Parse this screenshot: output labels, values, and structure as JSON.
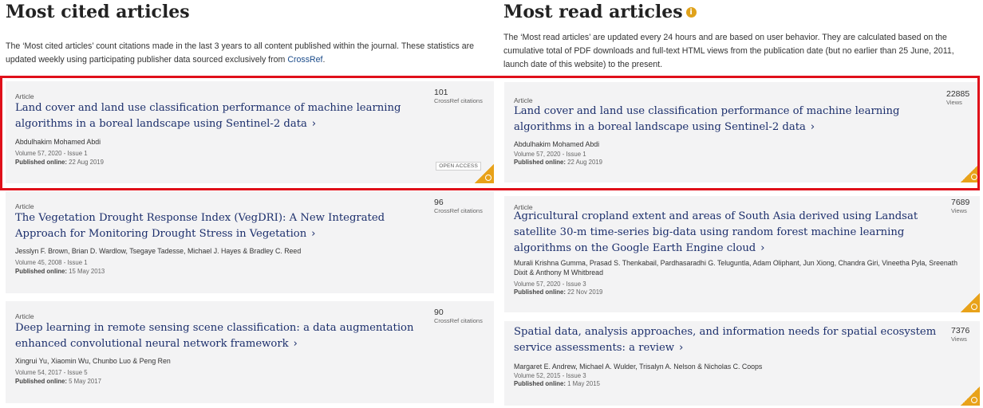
{
  "most_cited": {
    "title": "Most cited articles",
    "desc_pre": "The ‘Most cited articles’ count citations made in the last 3 years to all content published within the journal. These statistics are updated weekly using participating publisher data sourced exclusively from ",
    "desc_link": "CrossRef",
    "desc_post": ".",
    "articles": [
      {
        "type": "Article",
        "title": "Land cover and land use classification performance of machine learning algorithms in a boreal landscape using Sentinel-2 data",
        "authors": "Abdulhakim Mohamed Abdi",
        "volume": "Volume 57, 2020 - Issue 1",
        "published_label": "Published online:",
        "published_date": "22 Aug 2019",
        "metric_value": "101",
        "metric_label": "CrossRef citations",
        "badge": "OPEN ACCESS"
      },
      {
        "type": "Article",
        "title": "The Vegetation Drought Response Index (VegDRI): A New Integrated Approach for Monitoring Drought Stress in Vegetation",
        "authors": "Jesslyn F. Brown, Brian D. Wardlow, Tsegaye Tadesse, Michael J. Hayes & Bradley C. Reed",
        "volume": "Volume 45, 2008 - Issue 1",
        "published_label": "Published online:",
        "published_date": "15 May 2013",
        "metric_value": "96",
        "metric_label": "CrossRef citations"
      },
      {
        "type": "Article",
        "title": "Deep learning in remote sensing scene classification: a data augmentation enhanced convolutional neural network framework",
        "authors": "Xingrui Yu, Xiaomin Wu, Chunbo Luo & Peng Ren",
        "volume": "Volume 54, 2017 - Issue 5",
        "published_label": "Published online:",
        "published_date": "5 May 2017",
        "metric_value": "90",
        "metric_label": "CrossRef citations"
      }
    ]
  },
  "most_read": {
    "title": "Most read articles",
    "info_icon": "i",
    "desc": "The ‘Most read articles’ are updated every 24 hours and are based on user behavior. They are calculated based on the cumulative total of PDF downloads and full-text HTML views from the publication date (but no earlier than 25 June, 2011, launch date of this website) to the present.",
    "articles": [
      {
        "type": "Article",
        "title": "Land cover and land use classification performance of machine learning algorithms in a boreal landscape using Sentinel-2 data",
        "authors": "Abdulhakim Mohamed Abdi",
        "volume": "Volume 57, 2020 - Issue 1",
        "published_label": "Published online:",
        "published_date": "22 Aug 2019",
        "metric_value": "22885",
        "metric_label": "Views"
      },
      {
        "type": "Article",
        "title": "Agricultural cropland extent and areas of South Asia derived using Landsat satellite 30-m time-series big-data using random forest machine learning algorithms on the Google Earth Engine cloud",
        "authors": "Murali Krishna Gumma, Prasad S. Thenkabail, Pardhasaradhi G. Teluguntla, Adam Oliphant, Jun Xiong, Chandra Giri, Vineetha Pyla, Sreenath Dixit & Anthony M Whitbread",
        "volume": "Volume 57, 2020 - Issue 3",
        "published_label": "Published online:",
        "published_date": "22 Nov 2019",
        "metric_value": "7689",
        "metric_label": "Views"
      },
      {
        "type": "Article",
        "title": "Spatial data, analysis approaches, and information needs for spatial ecosystem service assessments: a review",
        "authors": "Margaret E. Andrew, Michael A. Wulder, Trisalyn A. Nelson & Nicholas C. Coops",
        "volume": "Volume 52, 2015 - Issue 3",
        "published_label": "Published online:",
        "published_date": "1 May 2015",
        "metric_value": "7376",
        "metric_label": "Views"
      }
    ]
  },
  "colors": {
    "title_link": "#1c2f6c",
    "highlight": "#e0101a",
    "open_access": "#e8a21a",
    "info": "#e0a21b"
  },
  "icons": {
    "chevron": "chevron-right-icon",
    "open_access": "open-access-icon",
    "info": "info-icon"
  }
}
